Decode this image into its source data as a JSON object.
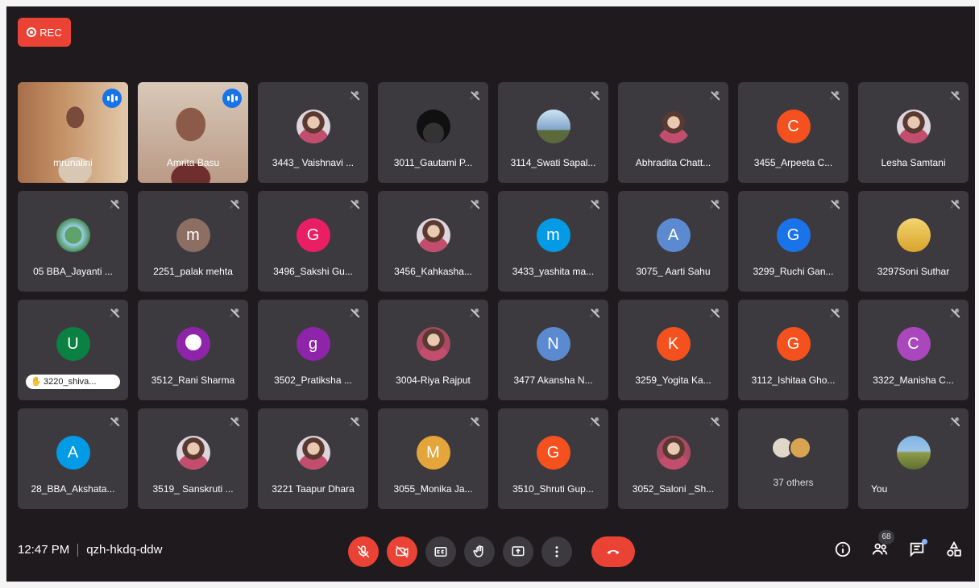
{
  "rec_label": "REC",
  "tiles": [
    {
      "name": "mrunalini",
      "type": "video1",
      "speaking": true
    },
    {
      "name": "Amrita Basu",
      "type": "video2",
      "speaking": true
    },
    {
      "name": "3443_ Vaishnavi ...",
      "avatar": "photo-light"
    },
    {
      "name": "3011_Gautami P...",
      "avatar": "photo-dark"
    },
    {
      "name": "3114_Swati Sapal...",
      "avatar": "photo-sky"
    },
    {
      "name": "Abhradita Chatt...",
      "avatar": "photo"
    },
    {
      "name": "3455_Arpeeta C...",
      "initial": "C",
      "color": "#f4511e"
    },
    {
      "name": "Lesha Samtani",
      "avatar": "photo-light"
    },
    {
      "name": "05 BBA_Jayanti ...",
      "avatar": "photo-globe"
    },
    {
      "name": "2251_palak mehta",
      "initial": "m",
      "color": "#8d6e63"
    },
    {
      "name": "3496_Sakshi Gu...",
      "initial": "G",
      "color": "#e91e63"
    },
    {
      "name": "3456_Kahkasha...",
      "avatar": "photo-light"
    },
    {
      "name": "3433_yashita ma...",
      "initial": "m",
      "color": "#039be5"
    },
    {
      "name": "3075_ Aarti Sahu",
      "initial": "A",
      "color": "#5b8ad1"
    },
    {
      "name": "3299_Ruchi Gan...",
      "initial": "G",
      "color": "#1a73e8"
    },
    {
      "name": "3297Soni Suthar",
      "avatar": "photo-yellow"
    },
    {
      "name": "3220_shiva...",
      "initial": "U",
      "color": "#0b8043",
      "hand": true
    },
    {
      "name": "3512_Rani Sharma",
      "initial": "person",
      "color": "#8e24aa"
    },
    {
      "name": "3502_Pratiksha ...",
      "initial": "g",
      "color": "#8e24aa"
    },
    {
      "name": "3004-Riya Rajput",
      "avatar": "photo-pink"
    },
    {
      "name": "3477 Akansha N...",
      "initial": "N",
      "color": "#5b8ad1"
    },
    {
      "name": "3259_Yogita Ka...",
      "initial": "K",
      "color": "#f4511e"
    },
    {
      "name": "3112_Ishitaa Gho...",
      "initial": "G",
      "color": "#f4511e"
    },
    {
      "name": "3322_Manisha C...",
      "initial": "C",
      "color": "#ab47bc"
    },
    {
      "name": "28_BBA_Akshata...",
      "initial": "A",
      "color": "#039be5"
    },
    {
      "name": "3519_ Sanskruti ...",
      "avatar": "photo-light"
    },
    {
      "name": "3221 Taapur Dhara",
      "avatar": "photo-light"
    },
    {
      "name": "3055_Monika Ja...",
      "initial": "M",
      "color": "#e4a53a"
    },
    {
      "name": "3510_Shruti Gup...",
      "initial": "G",
      "color": "#f4511e"
    },
    {
      "name": "3052_Saloni _Sh...",
      "avatar": "photo-pink"
    },
    {
      "name": "37 others",
      "type": "others"
    },
    {
      "name": "You",
      "avatar": "photo-field",
      "self": true
    }
  ],
  "bottom": {
    "time": "12:47 PM",
    "meeting_code": "qzh-hkdq-ddw",
    "participants_count": "68"
  },
  "icons": {
    "mic": "mic-off-icon",
    "camera": "camera-off-icon",
    "captions": "captions-icon",
    "hand": "raise-hand-icon",
    "present": "present-screen-icon",
    "more": "more-options-icon",
    "end": "end-call-icon",
    "info": "info-icon",
    "people": "people-icon",
    "chat": "chat-icon",
    "activities": "activities-icon"
  },
  "colors": {
    "background": "#1e1a1d",
    "tile": "#3c3a3f",
    "danger": "#ea4335",
    "accent": "#1a73e8"
  }
}
